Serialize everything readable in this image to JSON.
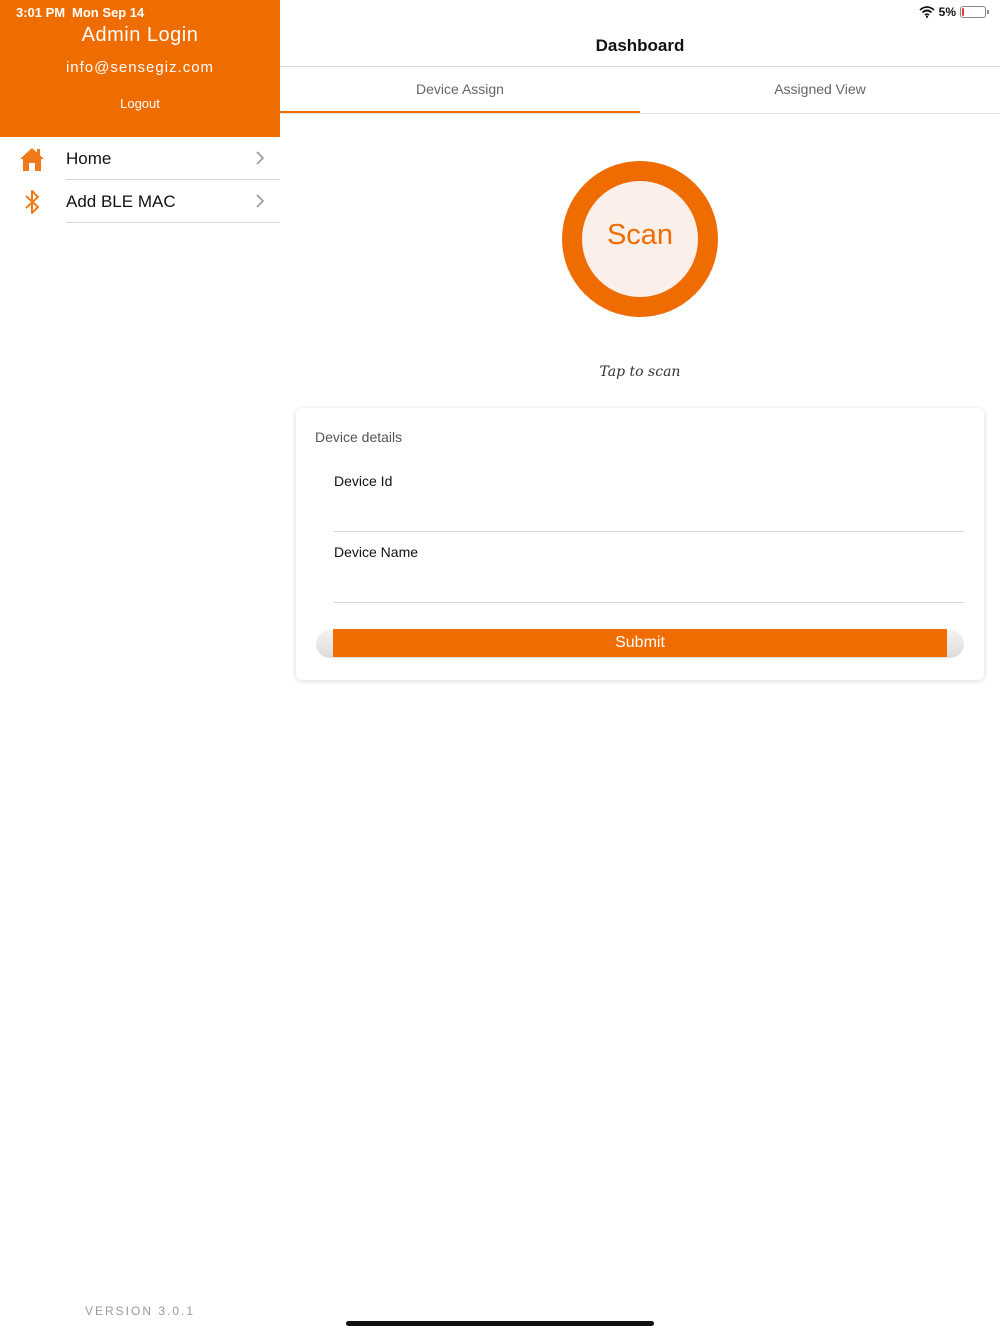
{
  "status_bar": {
    "time": "3:01 PM",
    "date": "Mon Sep 14",
    "battery": "5%",
    "battery_level": 0.05
  },
  "sidebar": {
    "header": {
      "title": "Admin Login",
      "email": "info@sensegiz.com",
      "logout_label": "Logout"
    },
    "items": [
      {
        "label": "Home",
        "icon": "home-icon"
      },
      {
        "label": "Add BLE MAC",
        "icon": "bluetooth-icon"
      }
    ],
    "version": "VERSION 3.0.1"
  },
  "main": {
    "title": "Dashboard",
    "tabs": [
      {
        "label": "Device Assign",
        "active": true
      },
      {
        "label": "Assigned View",
        "active": false
      }
    ],
    "scan": {
      "label": "Scan",
      "hint": "Tap to scan"
    },
    "form": {
      "title": "Device details",
      "device_id_label": "Device Id",
      "device_id_value": "",
      "device_name_label": "Device Name",
      "device_name_value": "",
      "submit_label": "Submit"
    }
  },
  "colors": {
    "accent": "#ef6c00",
    "scan_fill": "#fbefe9",
    "background": "#ffffff"
  }
}
